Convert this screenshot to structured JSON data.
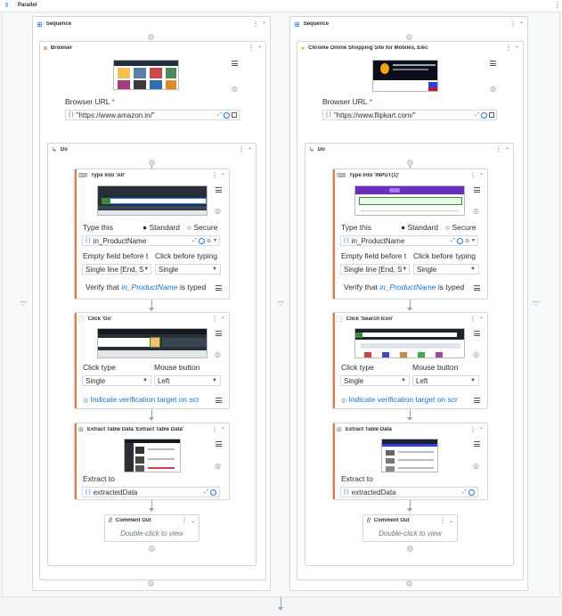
{
  "parallel": {
    "title": "Parallel"
  },
  "left": {
    "sequence_title": "Sequence",
    "browser": {
      "title": "Browser",
      "url_label": "Browser URL",
      "url_required": "*",
      "url_value": "\"https://www.amazon.in/\""
    },
    "do_title": "Do",
    "type_into": {
      "title": "Type Into 'All'",
      "type_this": "Type this",
      "standard": "Standard",
      "secure": "Secure",
      "value": "in_ProductName",
      "empty_field_label": "Empty field before t",
      "click_before_label": "Click before typing",
      "empty_field_value": "Single line [End, S",
      "click_before_value": "Single",
      "verify_prefix": "Verify that",
      "verify_var": "in_ProductName",
      "verify_suffix": "is typed"
    },
    "click": {
      "title": "Click 'Go'",
      "click_type_label": "Click type",
      "mouse_button_label": "Mouse button",
      "click_type_value": "Single",
      "mouse_button_value": "Left",
      "verification": "Indicate verification target on scr"
    },
    "extract": {
      "title": "Extract Table Data 'Extract Table Data'",
      "extract_to_label": "Extract to",
      "extract_to_value": "extractedData"
    },
    "comment": {
      "title": "Comment Out",
      "body": "Double-click to view"
    }
  },
  "right": {
    "sequence_title": "Sequence",
    "browser": {
      "title": "Chrome Online Shopping Site for Mobiles, Elec",
      "url_label": "Browser URL",
      "url_required": "*",
      "url_value": "\"https://www.flipkart.com/\""
    },
    "do_title": "Do",
    "type_into": {
      "title": "Type Into 'INPUT(1)'",
      "type_this": "Type this",
      "standard": "Standard",
      "secure": "Secure",
      "value": "in_ProductName",
      "empty_field_label": "Empty field before t",
      "click_before_label": "Click before typing",
      "empty_field_value": "Single line [End, S",
      "click_before_value": "Single",
      "verify_prefix": "Verify that",
      "verify_var": "in_ProductName",
      "verify_suffix": "is typed"
    },
    "click": {
      "title": "Click 'Search Icon'",
      "click_type_label": "Click type",
      "mouse_button_label": "Mouse button",
      "click_type_value": "Single",
      "mouse_button_value": "Left",
      "verification": "Indicate verification target on scr"
    },
    "extract": {
      "title": "Extract Table Data",
      "extract_to_label": "Extract to",
      "extract_to_value": "extractedData"
    },
    "comment": {
      "title": "Comment Out",
      "body": "Double-click to view"
    }
  },
  "colors": {
    "accent": "#1a73e8",
    "activity_bar": "#e8763d",
    "border": "#cfd8dd"
  }
}
